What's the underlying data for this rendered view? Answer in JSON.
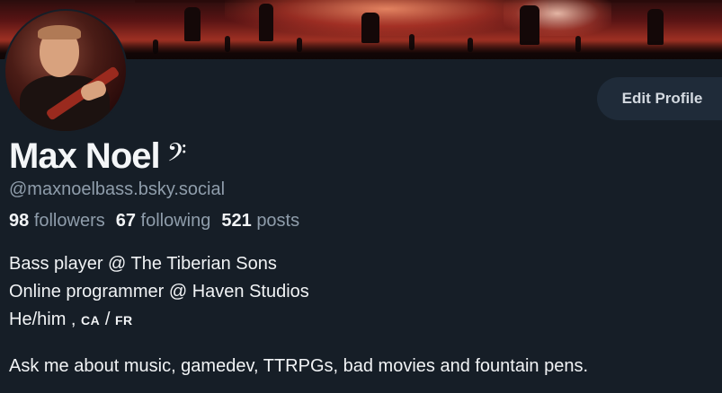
{
  "profile": {
    "display_name": "Max Noel",
    "name_emoji": "𝄢",
    "handle": "@maxnoelbass.bsky.social",
    "edit_button_label": "Edit Profile",
    "stats": {
      "followers_count": "98",
      "followers_label": "followers",
      "following_count": "67",
      "following_label": "following",
      "posts_count": "521",
      "posts_label": "posts"
    },
    "bio": {
      "line1": "Bass player @ The Tiberian Sons",
      "line2": "Online programmer @ Haven Studios",
      "line3_prefix": "He/him ,",
      "flag_ca": "CA",
      "line3_sep": "/",
      "flag_fr": "FR",
      "line4": "Ask me about music, gamedev, TTRPGs, bad movies and fountain pens."
    }
  },
  "colors": {
    "background": "#161e27",
    "text_primary": "#f1f3f5",
    "text_secondary": "#8f9dab",
    "button_bg": "#1f2b39"
  }
}
